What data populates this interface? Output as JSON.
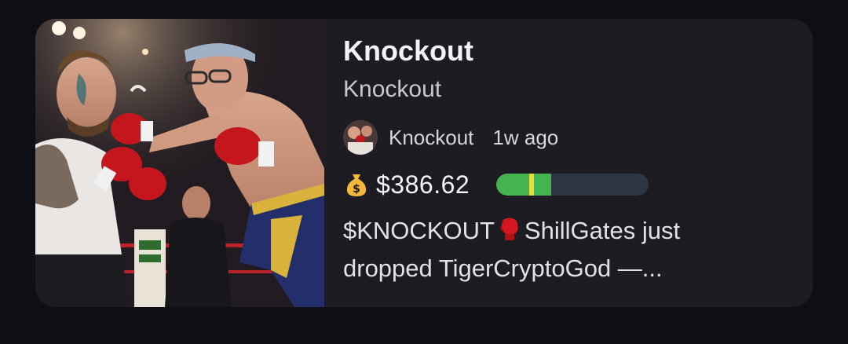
{
  "card": {
    "image_alt_icon": "boxing-scene-image",
    "title": "Knockout",
    "subtitle": "Knockout",
    "creator": {
      "avatar_icon": "creator-avatar",
      "name": "Knockout",
      "time_ago": "1w ago"
    },
    "market": {
      "icon": "money-bag-icon",
      "price": "$386.62",
      "progress_fraction": 0.36,
      "colors": {
        "fill": "#45b44f",
        "marker": "#e8dc3a",
        "track": "#2e3440"
      }
    },
    "description": {
      "before_emoji": "$KNOCKOUT",
      "emoji_icon": "boxing-glove-icon",
      "after_emoji": "ShillGates just dropped TigerCryptoGod —..."
    }
  }
}
